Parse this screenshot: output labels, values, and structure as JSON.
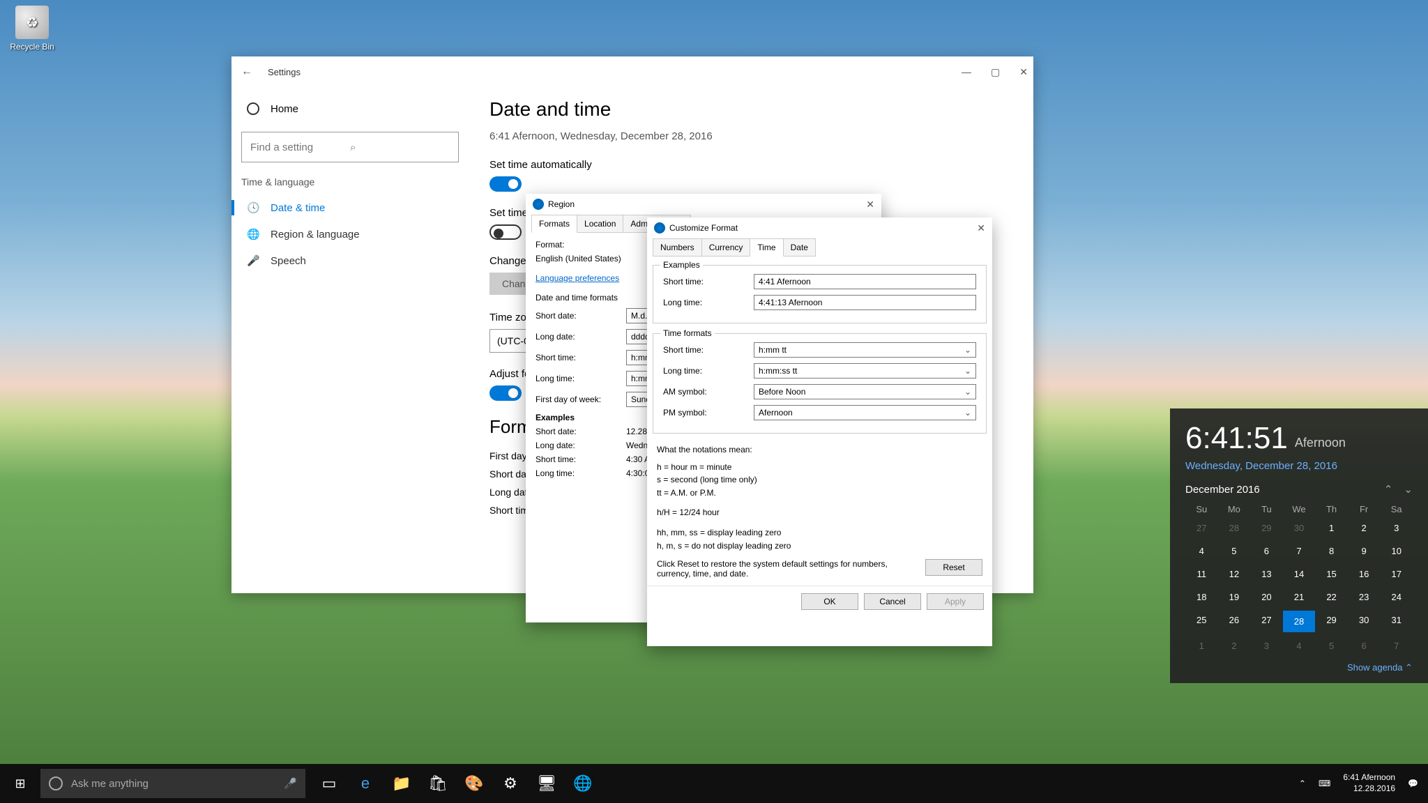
{
  "desktop": {
    "recycle_bin": "Recycle Bin"
  },
  "settings": {
    "title": "Settings",
    "home": "Home",
    "search_placeholder": "Find a setting",
    "section": "Time & language",
    "nav": {
      "date_time": "Date & time",
      "region": "Region & language",
      "speech": "Speech"
    },
    "page_title": "Date and time",
    "current": "6:41 Afernoon, Wednesday, December 28, 2016",
    "set_auto": "Set time automatically",
    "set_tz_auto": "Set time zone automatically",
    "change_label": "Change date and time",
    "change_btn": "Change",
    "tz_label": "Time zone",
    "tz_value": "(UTC-08:00) Pacific Time (US & Canada)",
    "adjust_dst": "Adjust for daylight saving time automatically",
    "formats": "Formats",
    "first_day": "First day of week:",
    "short_date": "Short date:",
    "long_date": "Long date:",
    "short_time": "Short time:"
  },
  "region": {
    "title": "Region",
    "tabs": {
      "formats": "Formats",
      "location": "Location",
      "administrative": "Administrative"
    },
    "format_label": "Format:",
    "format_value": "English (United States)",
    "lang_pref": "Language preferences",
    "dt_formats": "Date and time formats",
    "short_date_label": "Short date:",
    "short_date_val": "M.d.yyyy",
    "long_date_label": "Long date:",
    "long_date_val": "dddd, MMMM d, yyyy",
    "short_time_label": "Short time:",
    "short_time_val": "h:mm tt",
    "long_time_label": "Long time:",
    "long_time_val": "h:mm:ss tt",
    "first_day_label": "First day of week:",
    "first_day_val": "Sunday",
    "examples": "Examples",
    "ex_short_date": "12.28.2016",
    "ex_long_date": "Wednesday, December 28, 2016",
    "ex_short_time": "4:30 Afernoon",
    "ex_long_time": "4:30:00 Afernoon"
  },
  "custom": {
    "title": "Customize Format",
    "tabs": {
      "numbers": "Numbers",
      "currency": "Currency",
      "time": "Time",
      "date": "Date"
    },
    "examples": "Examples",
    "ex_short_label": "Short time:",
    "ex_short_val": "4:41 Afernoon",
    "ex_long_label": "Long time:",
    "ex_long_val": "4:41:13 Afernoon",
    "formats": "Time formats",
    "short_time_label": "Short time:",
    "short_time_val": "h:mm tt",
    "long_time_label": "Long time:",
    "long_time_val": "h:mm:ss tt",
    "am_label": "AM symbol:",
    "am_val": "Before Noon",
    "pm_label": "PM symbol:",
    "pm_val": "Afernoon",
    "notations_title": "What the notations mean:",
    "not1": "h = hour   m = minute",
    "not2": "s = second (long time only)",
    "not3": "tt = A.M. or P.M.",
    "not4": "h/H = 12/24 hour",
    "not5": "hh, mm, ss = display leading zero",
    "not6": "h, m, s = do not display leading zero",
    "reset_text": "Click Reset to restore the system default settings for numbers, currency, time, and date.",
    "reset": "Reset",
    "ok": "OK",
    "cancel": "Cancel",
    "apply": "Apply"
  },
  "flyout": {
    "time": "6:41:51",
    "ampm": "Afernoon",
    "date": "Wednesday, December 28, 2016",
    "month": "December 2016",
    "dh": [
      "Su",
      "Mo",
      "Tu",
      "We",
      "Th",
      "Fr",
      "Sa"
    ],
    "cells": [
      {
        "d": "27",
        "o": 1
      },
      {
        "d": "28",
        "o": 1
      },
      {
        "d": "29",
        "o": 1
      },
      {
        "d": "30",
        "o": 1
      },
      {
        "d": "1"
      },
      {
        "d": "2"
      },
      {
        "d": "3"
      },
      {
        "d": "4"
      },
      {
        "d": "5"
      },
      {
        "d": "6"
      },
      {
        "d": "7"
      },
      {
        "d": "8"
      },
      {
        "d": "9"
      },
      {
        "d": "10"
      },
      {
        "d": "11"
      },
      {
        "d": "12"
      },
      {
        "d": "13"
      },
      {
        "d": "14"
      },
      {
        "d": "15"
      },
      {
        "d": "16"
      },
      {
        "d": "17"
      },
      {
        "d": "18"
      },
      {
        "d": "19"
      },
      {
        "d": "20"
      },
      {
        "d": "21"
      },
      {
        "d": "22"
      },
      {
        "d": "23"
      },
      {
        "d": "24"
      },
      {
        "d": "25"
      },
      {
        "d": "26"
      },
      {
        "d": "27"
      },
      {
        "d": "28",
        "t": 1
      },
      {
        "d": "29"
      },
      {
        "d": "30"
      },
      {
        "d": "31"
      },
      {
        "d": "1",
        "o": 1
      },
      {
        "d": "2",
        "o": 1
      },
      {
        "d": "3",
        "o": 1
      },
      {
        "d": "4",
        "o": 1
      },
      {
        "d": "5",
        "o": 1
      },
      {
        "d": "6",
        "o": 1
      },
      {
        "d": "7",
        "o": 1
      }
    ],
    "agenda": "Show agenda ⌃"
  },
  "taskbar": {
    "cortana": "Ask me anything",
    "clock_time": "6:41 Afernoon",
    "clock_date": "12.28.2016"
  }
}
